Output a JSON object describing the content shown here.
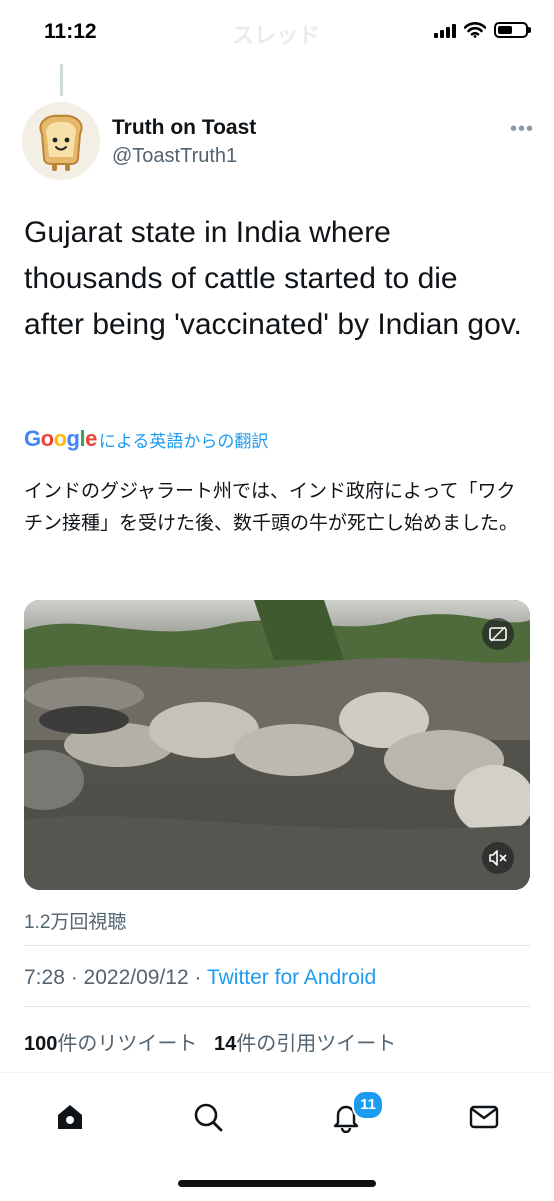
{
  "status_bar": {
    "time": "11:12",
    "ghost_title": "スレッド"
  },
  "author": {
    "name": "Truth on Toast",
    "handle": "@ToastTruth1",
    "avatar_icon": "toast-avatar-icon"
  },
  "tweet": {
    "text": "Gujarat state in India where thousands of cattle started to die after being 'vaccinated' by Indian gov.",
    "translation_provider": "Google",
    "translation_label": "による英語からの翻訳",
    "translated_text": "インドのグジャラート州では、インド政府によって「ワクチン接種」を受けた後、数千頭の牛が死亡し始めました。",
    "views": "1.2万回視聴",
    "time": "7:28",
    "date": "2022/09/12",
    "source": "Twitter for Android",
    "retweet_count": "100",
    "retweet_label": "件のリツイート",
    "quote_count": "14",
    "quote_label": "件の引用ツイート"
  },
  "media": {
    "type": "video",
    "controls": [
      "captions-icon",
      "mute-icon"
    ]
  },
  "tabbar": {
    "items": [
      "home-icon",
      "search-icon",
      "notifications-icon",
      "messages-icon"
    ],
    "notification_badge": "11"
  },
  "colors": {
    "link_blue": "#1d9bf0",
    "secondary_text": "#536471",
    "primary_text": "#0f1419"
  }
}
